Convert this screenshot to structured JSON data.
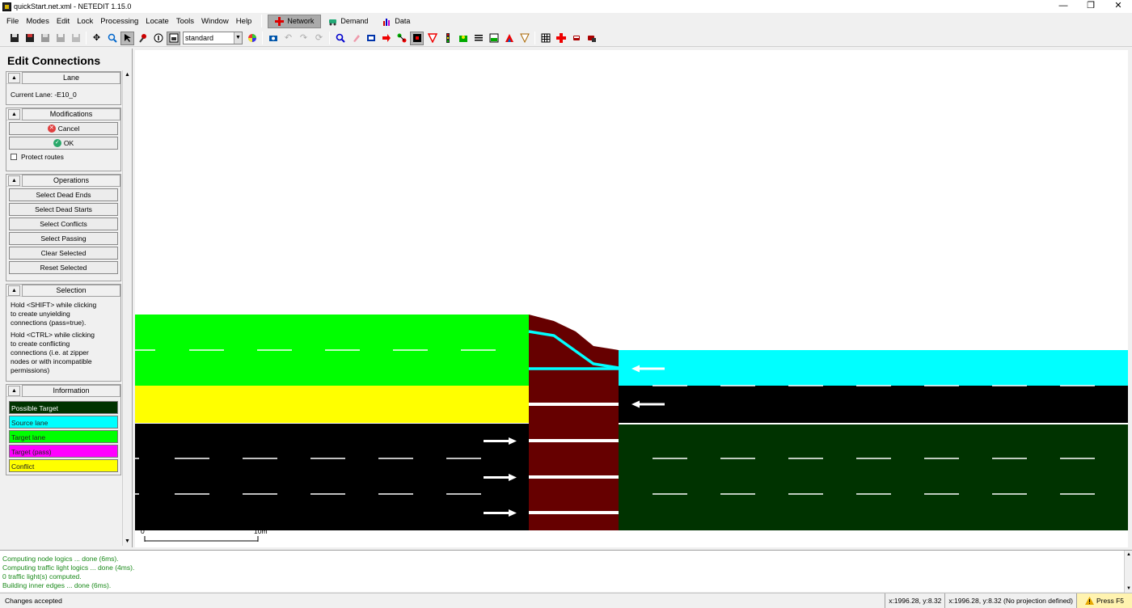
{
  "window": {
    "title": "quickStart.net.xml - NETEDIT 1.15.0",
    "minimize": "—",
    "restore": "❐",
    "close": "✕"
  },
  "menu": [
    {
      "label": "File"
    },
    {
      "label": "Modes"
    },
    {
      "label": "Edit"
    },
    {
      "label": "Lock"
    },
    {
      "label": "Processing"
    },
    {
      "label": "Locate"
    },
    {
      "label": "Tools"
    },
    {
      "label": "Window"
    },
    {
      "label": "Help"
    }
  ],
  "supermodes": {
    "network": "Network",
    "demand": "Demand",
    "data": "Data"
  },
  "toolbar": {
    "scheme_value": "standard"
  },
  "panel": {
    "title": "Edit Connections",
    "lane_header": "Lane",
    "current_lane": "Current Lane: -E10_0",
    "modifications_header": "Modifications",
    "cancel_label": "Cancel",
    "ok_label": "OK",
    "protect_routes_label": "Protect routes",
    "operations_header": "Operations",
    "ops": {
      "dead_ends": "Select Dead Ends",
      "dead_starts": "Select Dead Starts",
      "conflicts": "Select Conflicts",
      "passing": "Select Passing",
      "clear": "Clear Selected",
      "reset": "Reset Selected"
    },
    "selection_header": "Selection",
    "selection_text_1": "Hold <SHIFT> while clicking to create unyielding connections (pass=true).",
    "selection_text_2": "Hold <CTRL> while clicking to create conflicting connections (i.e. at zipper nodes or with incompatible permissions)",
    "information_header": "Information",
    "legend": {
      "possible_target": "Possible Target",
      "source_lane": "Source lane",
      "target_lane": "Target lane",
      "target_pass": "Target (pass)",
      "conflict": "Conflict"
    },
    "legend_colors": {
      "possible_target": "#003300",
      "source_lane": "#00ffff",
      "target_lane": "#00ff00",
      "target_pass": "#ff00ff",
      "conflict": "#ffff00"
    }
  },
  "canvas": {
    "scale_start": "0",
    "scale_end": "10m"
  },
  "messages": {
    "line1": "Computing node logics ... done (6ms).",
    "line2": "Computing traffic light logics ... done (4ms).",
    "line3": " 0 traffic light(s) computed.",
    "line4": "Building inner edges ... done (6ms)."
  },
  "status": {
    "text": "Changes accepted",
    "coord1": "x:1996.28, y:8.32",
    "coord2": "x:1996.28, y:8.32 (No projection defined)",
    "help": "Press F5"
  }
}
